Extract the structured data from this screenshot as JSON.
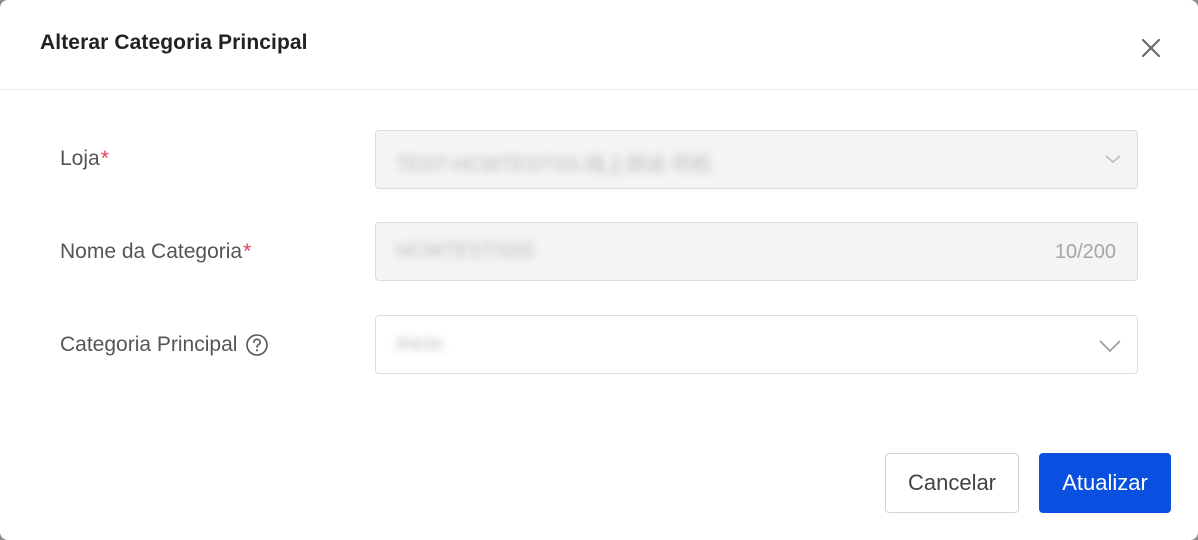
{
  "dialog": {
    "title": "Alterar Categoria Principal",
    "close_icon": "close-icon"
  },
  "form": {
    "store": {
      "label": "Loja",
      "required_mark": "*",
      "value": "TEST-HCWTESTSS-线上测试-司机",
      "icon": "chevron-down-icon"
    },
    "category_name": {
      "label": "Nome da Categoria",
      "required_mark": "*",
      "value": "HCWTESTSSS",
      "counter": "10/200"
    },
    "parent_category": {
      "label": "Categoria Principal",
      "help_icon": "question-circle-icon",
      "value": "Inicio",
      "icon": "chevron-down-icon"
    }
  },
  "footer": {
    "cancel_label": "Cancelar",
    "submit_label": "Atualizar"
  },
  "colors": {
    "primary": "#0a50e0",
    "required": "#e53c5c",
    "disabled_bg": "#f4f4f4"
  }
}
